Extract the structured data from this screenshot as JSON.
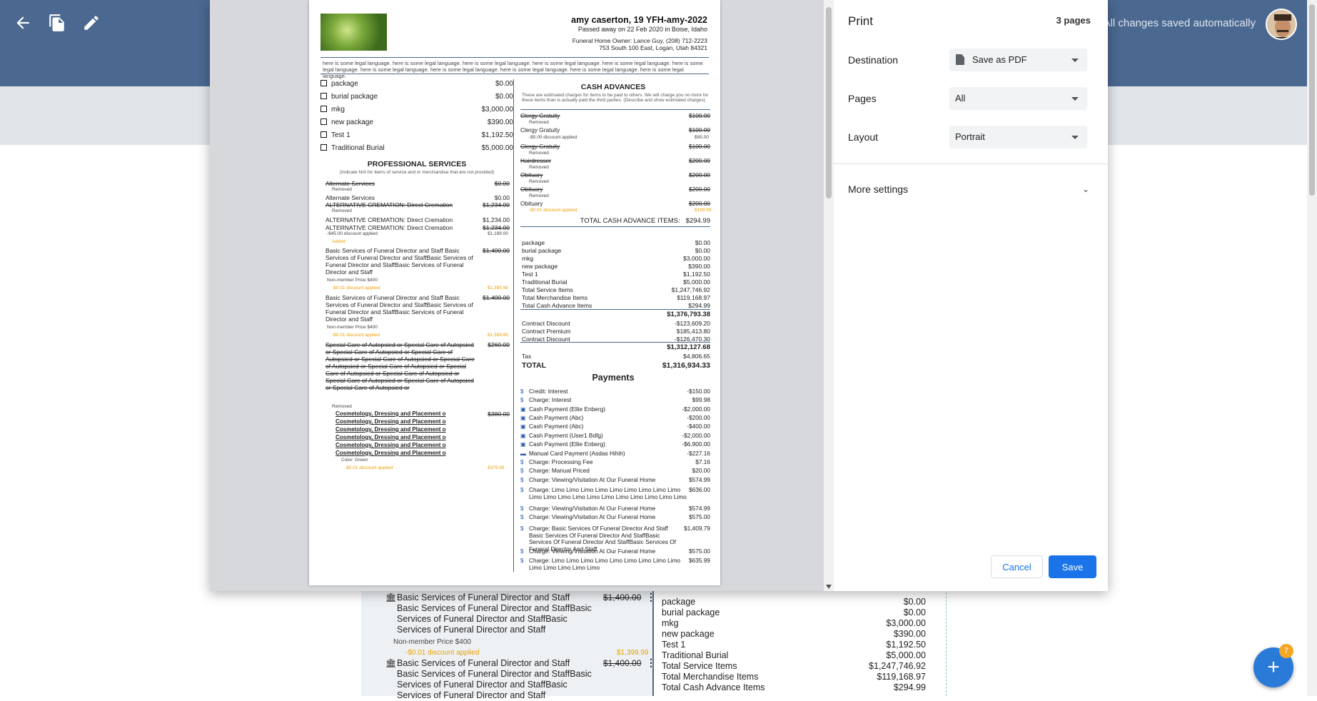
{
  "topbar": {
    "autosave": "All changes saved automatically"
  },
  "icons": {
    "back": "arrow-left-icon",
    "copy": "copy-icon",
    "edit": "pencil-icon"
  },
  "document": {
    "header": {
      "name": "amy caserton, 19  YFH-amy-2022",
      "passed": "Passed away on 22 Feb 2020 in Boise, Idaho",
      "owner": "Funeral Home Owner: Lance Guy, (208) 712-2223",
      "address": "753 South 100 East, Logan, Utah 84321"
    },
    "legal": "here is some legal language. here is some legal language. here is some legal language. here is some legal language. here is some legal language. here is some legal language. here is some legal language. here is some legal language. here is some legal language. here is some legal language. here is some legal language.",
    "packages": [
      {
        "name": "package",
        "price": "$0.00"
      },
      {
        "name": "burial package",
        "price": "$0.00"
      },
      {
        "name": "mkg",
        "price": "$3,000.00"
      },
      {
        "name": "new package",
        "price": "$390.00"
      },
      {
        "name": "Test 1",
        "price": "$1,192.50"
      },
      {
        "name": "Traditional Burial",
        "price": "$5,000.00"
      }
    ],
    "prof_title": "PROFESSIONAL SERVICES",
    "prof_sub": "(Indicate N/A for items of service and or merchandise that are not provided)",
    "prof": [
      {
        "name": "Alternate Services",
        "price": "$0.00"
      },
      {
        "name": "Alternate Services",
        "price": "$0.00"
      },
      {
        "name": "ALTERNATIVE CREMATION: Direct Cremation",
        "price": "$1,234.00"
      },
      {
        "name": "ALTERNATIVE CREMATION: Direct Cremation",
        "price": "$1,234.00"
      },
      {
        "name": "ALTERNATIVE CREMATION: Direct Cremation",
        "price": "$1,234.00"
      },
      {
        "name": "Basic Services of Funeral Director and Staff Basic Services of Funeral Director and StaffBasic Services of Funeral Director and StaffBasic Services of Funeral Director and Staff",
        "price": "$1,400.00"
      },
      {
        "name": "Basic Services of Funeral Director and Staff Basic Services of Funeral Director and StaffBasic Services of Funeral Director and StaffBasic Services of Funeral Director and Staff",
        "price": "$1,400.00"
      },
      {
        "name": "Special Care of Autopsied or Special Care of Autopsied or Special Care of Autopsied or Special Care of Autopsied or Special Care of Autopsied or Special Care of Autopsied or Special Care of Autopsied or Special Care of Autopsied or Special Care of Autopsied or Special Care of Autopsied or Special Care of Autopsied or Special Care of Autopsied or",
        "price": "$260.00"
      },
      {
        "name": "Cosmetology, Dressing and Placement o",
        "price": "$380.00"
      }
    ],
    "tags": {
      "removed": "Removed",
      "added": "Added",
      "disc45": "-$45.00 discount applied",
      "price1189": "$1,189.00",
      "nonmember": "Non-member Price $400",
      "disc001": "-$0.01 discount applied",
      "price1399": "$1,399.99",
      "color": "Color: Green",
      "price379": "$379.99",
      "disc5": "-$5.00 discount applied",
      "price95": "$95.00",
      "price19999": "$199.99"
    },
    "cash_title": "CASH ADVANCES",
    "cash_sub": "These are estimated charges for items to be paid to others. We will charge you no more for these items than is actually paid the third parties. (Describe and show estimated charges)",
    "cash": [
      {
        "name": "Clergy Gratuity",
        "price": "$100.00"
      },
      {
        "name": "Clergy Gratuity",
        "price": "$100.00"
      },
      {
        "name": "Clergy Gratuity",
        "price": "$100.00"
      },
      {
        "name": "Hairdresser",
        "price": "$200.00"
      },
      {
        "name": "Obituary",
        "price": "$200.00"
      },
      {
        "name": "Obituary",
        "price": "$200.00"
      },
      {
        "name": "Obituary",
        "price": "$200.00"
      }
    ],
    "cash_total_label": "TOTAL CASH ADVANCE ITEMS:",
    "cash_total": "$294.99",
    "summary": [
      {
        "label": "package",
        "value": "$0.00"
      },
      {
        "label": "burial package",
        "value": "$0.00"
      },
      {
        "label": "mkg",
        "value": "$3,000.00"
      },
      {
        "label": "new package",
        "value": "$390.00"
      },
      {
        "label": "Test 1",
        "value": "$1,192.50"
      },
      {
        "label": "Traditional Burial",
        "value": "$5,000.00"
      },
      {
        "label": "Total Service Items",
        "value": "$1,247,746.92"
      },
      {
        "label": "Total Merchandise Items",
        "value": "$119,168.97"
      },
      {
        "label": "Total Cash Advance Items",
        "value": "$294.99"
      }
    ],
    "subtotal1": "$1,376,793.38",
    "discounts": [
      {
        "label": "Contract Discount",
        "value": "-$123,609.20"
      },
      {
        "label": "Contract Premium",
        "value": "$185,413.80"
      },
      {
        "label": "Contract Discount",
        "value": "-$126,470.30"
      }
    ],
    "subtotal2": "$1,312,127.68",
    "tax_label": "Tax",
    "tax": "$4,806.65",
    "total_label": "TOTAL",
    "total": "$1,316,934.33",
    "payments_title": "Payments",
    "payments": [
      {
        "icon": "$",
        "name": "Credit: Interest",
        "value": "-$150.00"
      },
      {
        "icon": "$",
        "name": "Charge: Interest",
        "value": "$99.98"
      },
      {
        "icon": "▣",
        "name": "Cash Payment (Ellie Enberg)",
        "value": "-$2,000.00"
      },
      {
        "icon": "▣",
        "name": "Cash Payment (Abc)",
        "value": "-$200.00"
      },
      {
        "icon": "▣",
        "name": "Cash Payment (Abc)",
        "value": "-$400.00"
      },
      {
        "icon": "▣",
        "name": "Cash Payment (User1 Bdfg)",
        "value": "-$2,000.00"
      },
      {
        "icon": "▣",
        "name": "Cash Payment (Ellie Enberg)",
        "value": "-$6,900.00"
      },
      {
        "icon": "▬",
        "name": "Manual Card Payment (Asdas Hihih)",
        "value": "-$227.16"
      },
      {
        "icon": "$",
        "name": "Charge: Processing Fee",
        "value": "$7.16"
      },
      {
        "icon": "$",
        "name": "Charge: Manual Priced",
        "value": "$20.00"
      },
      {
        "icon": "$",
        "name": "Charge: Viewing/Visitation At Our Funeral Home",
        "value": "$574.99"
      },
      {
        "icon": "$",
        "name": "Charge: Limo Limo Limo Limo Limo Limo Limo Limo Limo Limo Limo Limo Limo Limo Limo Limo Limo Limo Limo Limo",
        "value": "$636.00"
      },
      {
        "icon": "$",
        "name": "Charge: Viewing/Visitation At Our Funeral Home",
        "value": "$574.99"
      },
      {
        "icon": "$",
        "name": "Charge: Viewing/Visitation At Our Funeral Home",
        "value": "$575.00"
      },
      {
        "icon": "$",
        "name": "Charge: Basic Services Of Funeral Director And Staff Basic Services Of Funeral Director And StaffBasic Services Of Funeral Director And StaffBasic Services Of Funeral Director And Staff",
        "value": "$1,409.79"
      },
      {
        "icon": "$",
        "name": "Charge: Viewing/Visitation At Our Funeral Home",
        "value": "$575.00"
      },
      {
        "icon": "$",
        "name": "Charge: Limo Limo Limo Limo Limo Limo Limo Limo Limo Limo Limo Limo Limo Limo",
        "value": "$635.99"
      }
    ]
  },
  "print": {
    "title": "Print",
    "pages_count": "3 pages",
    "destination_label": "Destination",
    "destination_value": "Save as PDF",
    "pages_label": "Pages",
    "pages_value": "All",
    "layout_label": "Layout",
    "layout_value": "Portrait",
    "more_settings": "More settings",
    "cancel": "Cancel",
    "save": "Save"
  },
  "background": {
    "item1": "Basic Services of Funeral Director and Staff Basic Services of Funeral Director and StaffBasic Services of Funeral Director and StaffBasic Services of Funeral Director and Staff",
    "item1_price": "$1,400.00",
    "nonmember": "Non-member Price $400",
    "discount": "-$0.01 discount applied",
    "discount_price": "$1,399.99",
    "item2": "Basic Services of Funeral Director and Staff Basic Services of Funeral Director and StaffBasic Services of Funeral Director and StaffBasic Services of Funeral Director and Staff",
    "item2_price": "$1,400.00",
    "summary": [
      {
        "label": "package",
        "value": "$0.00"
      },
      {
        "label": "burial package",
        "value": "$0.00"
      },
      {
        "label": "mkg",
        "value": "$3,000.00"
      },
      {
        "label": "new package",
        "value": "$390.00"
      },
      {
        "label": "Test 1",
        "value": "$1,192.50"
      },
      {
        "label": "Traditional Burial",
        "value": "$5,000.00"
      },
      {
        "label": "Total Service Items",
        "value": "$1,247,746.92"
      },
      {
        "label": "Total Merchandise Items",
        "value": "$119,168.97"
      },
      {
        "label": "Total Cash Advance Items",
        "value": "$294.99"
      }
    ]
  },
  "fab": {
    "label": "+",
    "badge": "7"
  }
}
